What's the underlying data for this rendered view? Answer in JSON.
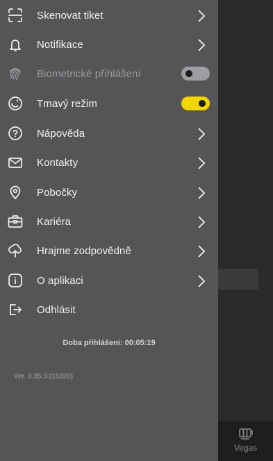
{
  "menu": {
    "items": [
      {
        "label": "Skenovat tiket",
        "icon": "scan-icon"
      },
      {
        "label": "Notifikace",
        "icon": "bell-icon"
      },
      {
        "label": "Biometrické přihlášení",
        "icon": "fingerprint-icon",
        "toggle": false
      },
      {
        "label": "Tmavý režim",
        "icon": "dark-mode-icon",
        "toggle": true
      },
      {
        "label": "Nápověda",
        "icon": "help-icon"
      },
      {
        "label": "Kontakty",
        "icon": "mail-icon"
      },
      {
        "label": "Pobočky",
        "icon": "location-pin-icon"
      },
      {
        "label": "Kariéra",
        "icon": "briefcase-icon"
      },
      {
        "label": "Hrajme zodpovědně",
        "icon": "responsible-gaming-icon"
      },
      {
        "label": "O aplikaci",
        "icon": "info-icon"
      },
      {
        "label": "Odhlásit",
        "icon": "logout-icon"
      }
    ]
  },
  "footer": {
    "login_time": "Doba přihlášení: 00:05:19",
    "version": "Ver. 3.35.3 (15320)"
  },
  "background": {
    "bottom_tab_label": "Vegas"
  },
  "colors": {
    "drawer_bg": "#555558",
    "accent_yellow": "#f3d500",
    "text": "#f2f2f2"
  }
}
